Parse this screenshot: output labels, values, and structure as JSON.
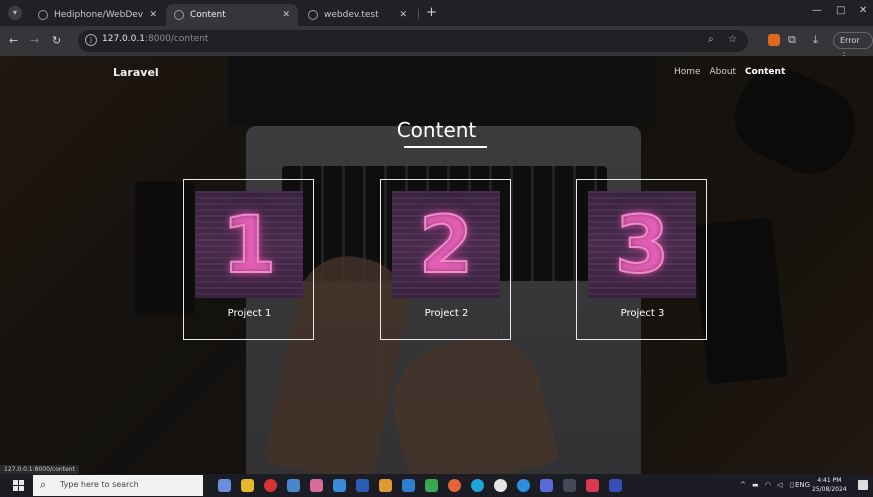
{
  "browser": {
    "tabs": [
      {
        "title": "Hediphone/WebDev",
        "active": false
      },
      {
        "title": "Content",
        "active": true
      },
      {
        "title": "webdev.test",
        "active": false
      }
    ],
    "tab_close": "✕",
    "new_tab": "+",
    "url_host": "127.0.0.1",
    "url_path": ":8000/content",
    "error_label": "Error"
  },
  "site": {
    "brand": "Laravel",
    "nav": [
      {
        "label": "Home"
      },
      {
        "label": "About"
      },
      {
        "label": "Content",
        "current": true
      }
    ],
    "title": "Content",
    "projects": [
      {
        "number": "1",
        "label": "Project 1"
      },
      {
        "number": "2",
        "label": "Project 2"
      },
      {
        "number": "3",
        "label": "Project 3"
      }
    ]
  },
  "status_bar_url": "127.0.0.1:8000/content",
  "taskbar": {
    "search_placeholder": "Type here to search",
    "language": "ENG",
    "time": "4:41 PM",
    "date": "25/08/2024"
  },
  "colors": {
    "neon": "#f08ac8",
    "chrome_bg": "#202124",
    "taskbar_bg": "#1c1d24"
  }
}
